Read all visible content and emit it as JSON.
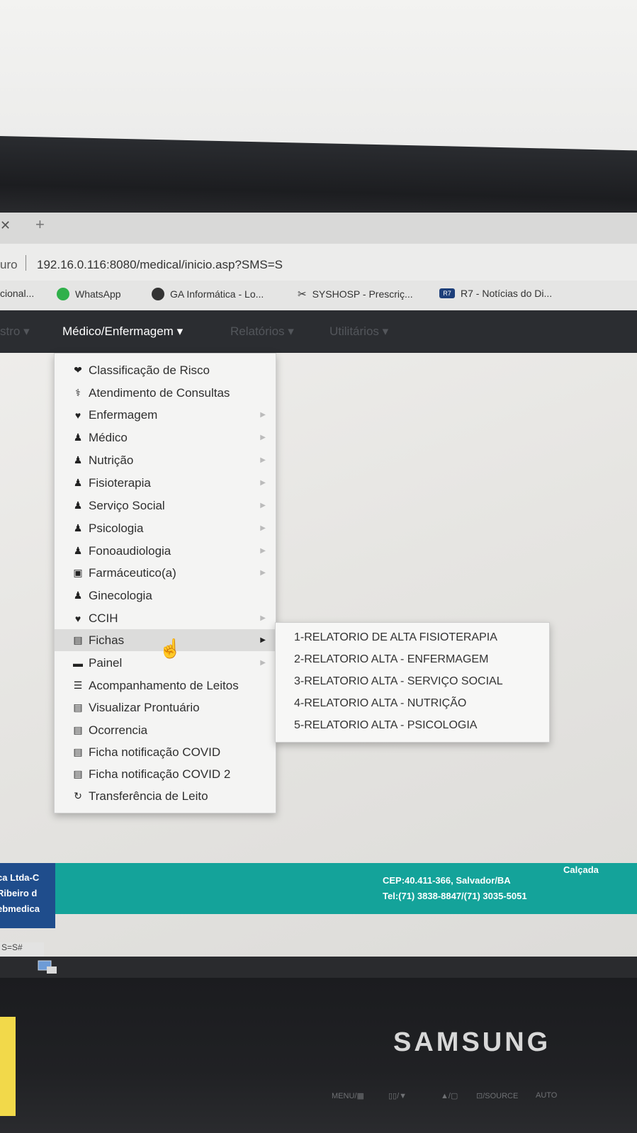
{
  "browser": {
    "address_prefix": "uro",
    "url": "192.16.0.116:8080/medical/inicio.asp?SMS=S",
    "tab_close_icon": "close-icon",
    "new_tab_icon": "plus-icon"
  },
  "bookmarks": [
    {
      "label": "cional...",
      "icon": ""
    },
    {
      "label": "WhatsApp",
      "icon": "whatsapp-icon"
    },
    {
      "label": "GA Informática - Lo...",
      "icon": "globe-icon"
    },
    {
      "label": "SYSHOSP - Prescriç...",
      "icon": "tools-icon"
    },
    {
      "label": "R7 - Notícias do Di...",
      "icon": "r7-icon"
    }
  ],
  "nav": {
    "items": [
      {
        "label": "stro",
        "caret": "▾",
        "state": "dim"
      },
      {
        "label": "Médico/Enfermagem",
        "caret": "▾",
        "state": "active"
      },
      {
        "label": "Relatórios",
        "caret": "▾",
        "state": "dim"
      },
      {
        "label": "Utilitários",
        "caret": "▾",
        "state": "dim"
      }
    ]
  },
  "menu": {
    "items": [
      {
        "label": "Classificação de Risco",
        "icon": "heartbeat-icon",
        "submenu": false
      },
      {
        "label": "Atendimento de Consultas",
        "icon": "stethoscope-icon",
        "submenu": false
      },
      {
        "label": "Enfermagem",
        "icon": "heart-icon",
        "submenu": true
      },
      {
        "label": "Médico",
        "icon": "user-md-icon",
        "submenu": true
      },
      {
        "label": "Nutrição",
        "icon": "user-md-icon",
        "submenu": true
      },
      {
        "label": "Fisioterapia",
        "icon": "user-md-icon",
        "submenu": true
      },
      {
        "label": "Serviço Social",
        "icon": "user-md-icon",
        "submenu": true
      },
      {
        "label": "Psicologia",
        "icon": "user-md-icon",
        "submenu": true
      },
      {
        "label": "Fonoaudiologia",
        "icon": "user-md-icon",
        "submenu": true
      },
      {
        "label": "Farmáceutico(a)",
        "icon": "medkit-icon",
        "submenu": true
      },
      {
        "label": "Ginecologia",
        "icon": "user-md-icon",
        "submenu": false
      },
      {
        "label": "CCIH",
        "icon": "heart-icon",
        "submenu": true
      },
      {
        "label": "Fichas",
        "icon": "list-alt-icon",
        "submenu": true,
        "active": true
      },
      {
        "label": "Painel",
        "icon": "monitor-icon",
        "submenu": true
      },
      {
        "label": "Acompanhamento de Leitos",
        "icon": "bed-icon",
        "submenu": false
      },
      {
        "label": "Visualizar Prontuário",
        "icon": "list-alt-icon",
        "submenu": false
      },
      {
        "label": "Ocorrencia",
        "icon": "list-alt-icon",
        "submenu": false
      },
      {
        "label": "Ficha notificação COVID",
        "icon": "list-alt-icon",
        "submenu": false
      },
      {
        "label": "Ficha notificação COVID 2",
        "icon": "list-alt-icon",
        "submenu": false
      },
      {
        "label": "Transferência de Leito",
        "icon": "refresh-icon",
        "submenu": false
      }
    ]
  },
  "submenu": {
    "items": [
      "1-RELATORIO DE ALTA FISIOTERAPIA",
      "2-RELATORIO ALTA - ENFERMAGEM",
      "3-RELATORIO ALTA - SERVIÇO SOCIAL",
      "4-RELATORIO ALTA - NUTRIÇÃO",
      "5-RELATORIO ALTA - PSICOLOGIA"
    ]
  },
  "footer": {
    "left_lines": [
      "ca Ltda-C",
      "Ribeiro d",
      "ebmedica"
    ],
    "right_calcada": "Calçada",
    "right_cep": "CEP:40.411-366, Salvador/BA",
    "right_tel": "Tel:(71) 3838-8847/(71) 3035-5051"
  },
  "status_text": "S=S#",
  "monitor": {
    "brand": "SAMSUNG",
    "controls": [
      "MENU/▦",
      "▯▯/▼",
      "▲/▢",
      "⊡/SOURCE",
      "AUTO"
    ]
  },
  "colors": {
    "navbar": "#2b2d31",
    "footer_teal": "#14a39a",
    "footer_blue": "#1f4d8c"
  }
}
